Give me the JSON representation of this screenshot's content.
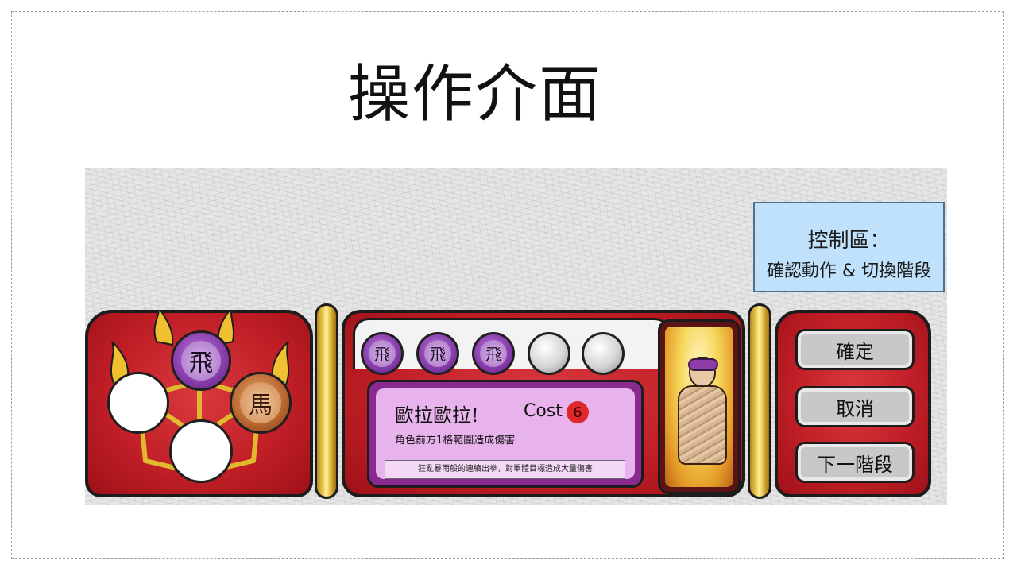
{
  "slide": {
    "title": "操作介面"
  },
  "callout": {
    "title": "控制區：",
    "subtitle": "確認動作 & 切換階段"
  },
  "pieces": {
    "tree_top": "飛",
    "tree_right": "馬",
    "slot_1": "飛",
    "slot_2": "飛",
    "slot_3": "飛"
  },
  "card": {
    "name": "歐拉歐拉!",
    "cost_label": "Cost",
    "cost_value": "6",
    "description": "角色前方1格範圍造成傷害",
    "flavor": "狂亂暴雨般的連續出拳，對單體目標造成大量傷害"
  },
  "controls": {
    "confirm": "確定",
    "cancel": "取消",
    "next_phase": "下一階段"
  }
}
